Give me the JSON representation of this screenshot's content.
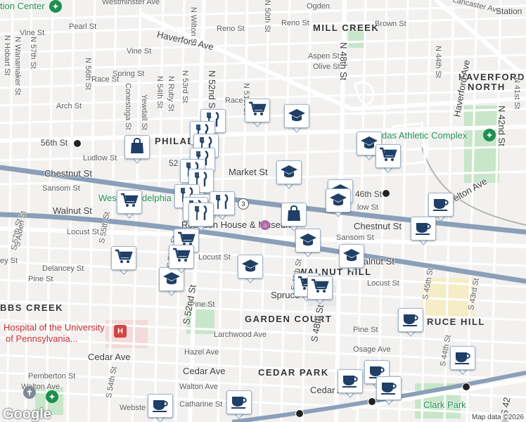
{
  "map": {
    "attribution": "Map data ©2026",
    "logo": "Google",
    "colors": {
      "land": "#f2f1ef",
      "road": "#ffffff",
      "rail": "#8a9fb8",
      "park": "#c8e6c9",
      "marker_border": "#9fb4cc",
      "marker_icon": "#1f3f66",
      "poi_green": "#1d8f4f",
      "poi_red": "#c5282f"
    }
  },
  "labels": {
    "westminster": "Westminster Ave",
    "station_center": "tion Center",
    "ogden": "Ogden",
    "lancaster": "Lancaster Ave",
    "station_top_right": "Station",
    "vine": "Vine St",
    "pearl": "Pearl St",
    "reno1": "Reno St",
    "reno2": "Reno St",
    "brown": "Brown St",
    "mill_creek": "MILL CREEK",
    "haverford_ave_top": "Haverford Ave",
    "vine2": "Vine St",
    "aspen": "Aspen St",
    "olive": "Olive St",
    "haverford_north_1": "HAVERFORD",
    "haverford_north_2": "NORTH",
    "spring": "Spring St",
    "race1": "Race St",
    "race2": "Race",
    "arch": "Arch St",
    "haverford_ave_right": "Haverford Ave",
    "athletic": "das Athletic Complex",
    "56th_station": "56th St",
    "philad": "PHILAD",
    "market": "Market St",
    "ludlow": "Ludlow St",
    "52nd": "52",
    "chestnut_left": "Chestnut St",
    "sansom_left": "Sansom St",
    "west_philadelphia": "West Philadelphia",
    "46th_station": "46th St",
    "powelton": "Powelton Ave",
    "walnut_left": "Walnut St",
    "chestnut_right": "Chestnut St",
    "ludlow_right": "low St",
    "museum": "Robeson House & Museum",
    "sansom_right": "Sansom St",
    "walnut_right": "Walnut St",
    "walnut_hill": "WALNUT HILL",
    "locust_left": "Locust St",
    "locust_mid": "Locust St",
    "locust_right": "Locust St",
    "delancey": "Delancey St",
    "ey_st": "ey St",
    "pine_left": "Pine St",
    "pine_mid": "Pine St",
    "pine_right": "Pine St",
    "spruce": "Spruce",
    "cobbs_creek": "BBS CREEK",
    "garden_court": "GARDEN COURT",
    "spruce_hill": "RUCE HILL",
    "hospital_1": "Hospital of the University",
    "hospital_2": "of Pennsylvania...",
    "larchwood": "Larchwood Ave",
    "osage": "Osage Ave",
    "hazel": "Hazel Ave",
    "cedar_left": "Cedar Ave",
    "cedar_mid": "Cedar Ave",
    "cedar_right": "Cedar Ave",
    "cedar_park": "CEDAR PARK",
    "pemberton": "Pemberton St",
    "walton_left": "Walton Ave",
    "walton_mid": "Walton Ave",
    "catharine": "Catharine St",
    "webster": "Webste",
    "clark_park": "Clark Park",
    "n57": "N 57th St",
    "n56": "N 56th St",
    "hobart": "N Hobart St",
    "wanamaker": "N Wanamaker St",
    "conestoga": "Conestoga St",
    "yewdall": "Yewdall St",
    "n54": "N 54th St",
    "ruby": "N Ruby St",
    "n53": "N 53rd St",
    "wilton": "N Wilton St",
    "n52": "N 52nd St",
    "n51": "N 51st St",
    "n50": "N 50th St",
    "n48": "N 48th St",
    "n44": "N 44th St",
    "n42": "N 42nd St",
    "n41": "N 41st St",
    "s57": "S 57th St",
    "s55": "S 55th St",
    "s54": "S 54th St",
    "s53": "S 53rd St",
    "s52": "S 52nd St",
    "s49": "S 49th St",
    "s48": "S 48th St",
    "s45": "S 45th St",
    "s44": "S 44th St",
    "s43": "S 43rd St",
    "s42": "S 42",
    "alden": "S Alden St",
    "route3": "3"
  },
  "markers": [
    {
      "type": "school",
      "label": "school-marker"
    },
    {
      "type": "grocery",
      "label": "grocery-marker"
    },
    {
      "type": "restaurant",
      "label": "restaurant-marker"
    },
    {
      "type": "shopping",
      "label": "shopping-marker"
    },
    {
      "type": "cafe",
      "label": "cafe-marker"
    }
  ]
}
